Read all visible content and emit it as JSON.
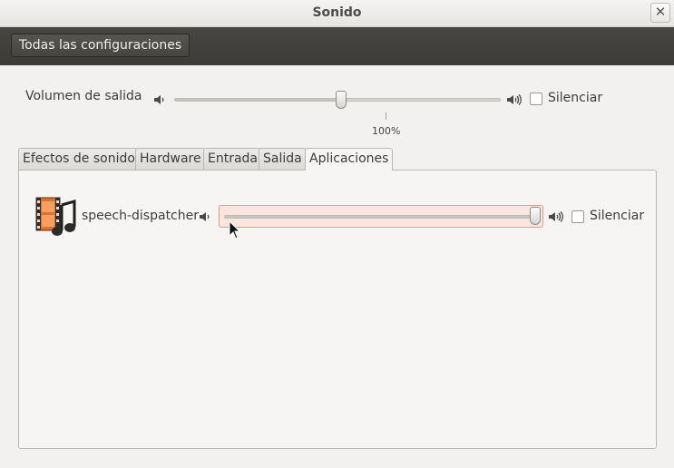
{
  "window": {
    "title": "Sonido"
  },
  "toolbar": {
    "all_settings_label": "Todas las configuraciones"
  },
  "output_volume": {
    "label": "Volumen de salida",
    "level_percent": 50,
    "mark_label": "100%",
    "mute_label": "Silenciar",
    "muted": false
  },
  "tabs": [
    {
      "label": "Efectos de sonido",
      "active": false
    },
    {
      "label": "Hardware",
      "active": false
    },
    {
      "label": "Entrada",
      "active": false
    },
    {
      "label": "Salida",
      "active": false
    },
    {
      "label": "Aplicaciones",
      "active": true
    }
  ],
  "applications": [
    {
      "name": "speech-dispatcher",
      "icon": "multimedia-icon",
      "level_percent": 100,
      "mute_label": "Silenciar",
      "muted": false
    }
  ],
  "icons": {
    "volume_low": "speaker-low-icon",
    "volume_high": "speaker-high-icon",
    "close": "close-icon"
  },
  "colors": {
    "toolbar_bg": "#3c3b37",
    "highlight_border": "#e79a86",
    "highlight_bg": "#fbe5df"
  }
}
